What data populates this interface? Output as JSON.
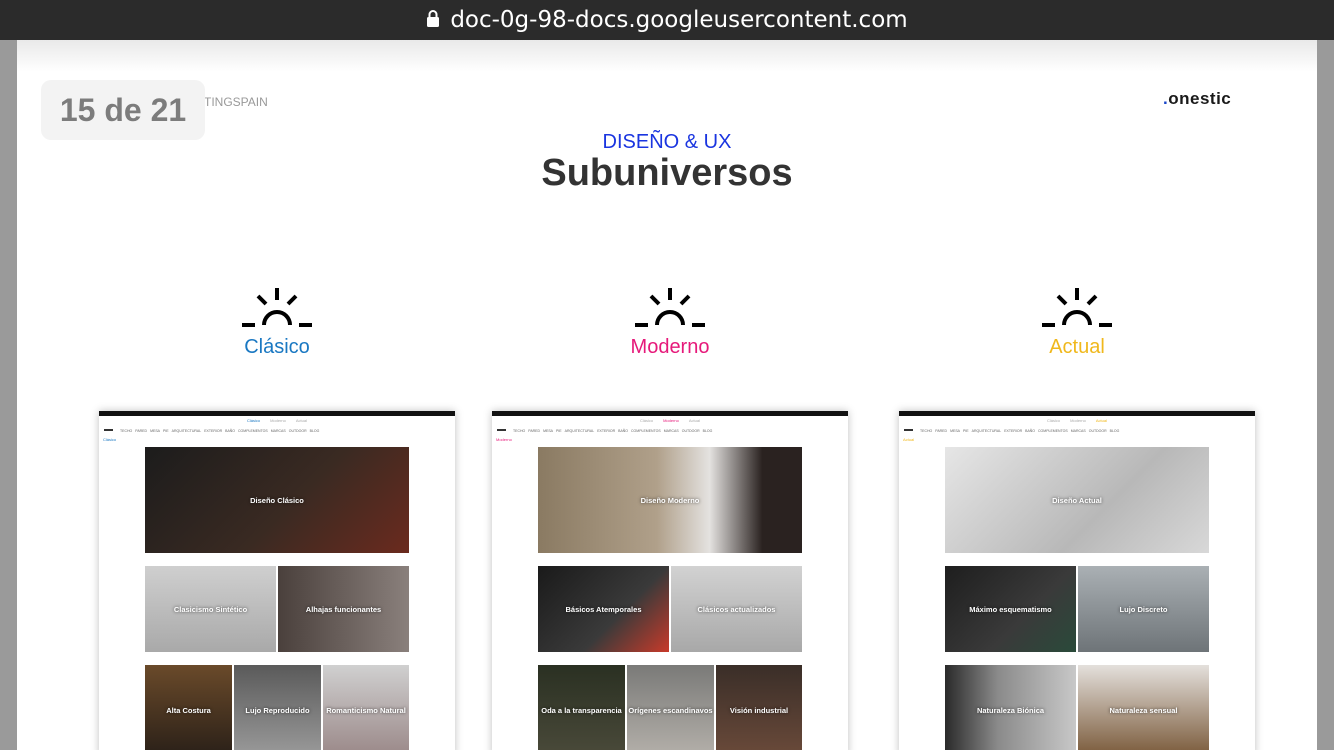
{
  "browser": {
    "url": "doc-0g-98-docs.googleusercontent.com"
  },
  "viewer": {
    "page_counter": "15 de 21"
  },
  "slide": {
    "brand_left": "TINGSPAIN",
    "logo": {
      "dot": ".",
      "text": "onestic",
      "dot_color": "#1a47c9"
    },
    "subtitle": "DISEÑO & UX",
    "title": "Subuniversos",
    "columns": [
      {
        "label": "Clásico",
        "color": "#1a78c2",
        "icon": "sunrise-icon",
        "screenshot": {
          "tabs": [
            "Clásico",
            "Moderno",
            "Actual"
          ],
          "nav": [
            "TECHO",
            "PARED",
            "MESA",
            "PIE",
            "ARQUITECTURAL",
            "EXTERIOR",
            "BAÑO",
            "COMPLEMENTOS",
            "MARCAS",
            "OUTDOOR",
            "BLOG"
          ],
          "section_label": "Clásico",
          "hero": "Diseño Clásico",
          "row2": [
            "Clasicismo Sintético",
            "Alhajas funcionantes"
          ],
          "row3": [
            "Alta Costura",
            "Lujo Reproducido",
            "Romanticismo Natural"
          ]
        }
      },
      {
        "label": "Moderno",
        "color": "#e6197a",
        "icon": "sunrise-icon",
        "screenshot": {
          "tabs": [
            "Clásico",
            "Moderno",
            "Actual"
          ],
          "nav": [
            "TECHO",
            "PARED",
            "MESA",
            "PIE",
            "ARQUITECTURAL",
            "EXTERIOR",
            "BAÑO",
            "COMPLEMENTOS",
            "MARCAS",
            "OUTDOOR",
            "BLOG"
          ],
          "section_label": "Moderno",
          "hero": "Diseño Moderno",
          "row2": [
            "Básicos Atemporales",
            "Clásicos actualizados"
          ],
          "row3": [
            "Oda a la transparencia",
            "Orígenes escandinavos",
            "Visión industrial"
          ]
        }
      },
      {
        "label": "Actual",
        "color": "#f0b81c",
        "icon": "sunrise-icon",
        "screenshot": {
          "tabs": [
            "Clásico",
            "Moderno",
            "Actual"
          ],
          "nav": [
            "TECHO",
            "PARED",
            "MESA",
            "PIE",
            "ARQUITECTURAL",
            "EXTERIOR",
            "BAÑO",
            "COMPLEMENTOS",
            "MARCAS",
            "OUTDOOR",
            "BLOG"
          ],
          "section_label": "Actual",
          "hero": "Diseño Actual",
          "row2": [
            "Máximo esquematismo",
            "Lujo Discreto"
          ],
          "row3": [
            "Naturaleza Biónica",
            "Naturaleza sensual"
          ]
        }
      }
    ]
  }
}
